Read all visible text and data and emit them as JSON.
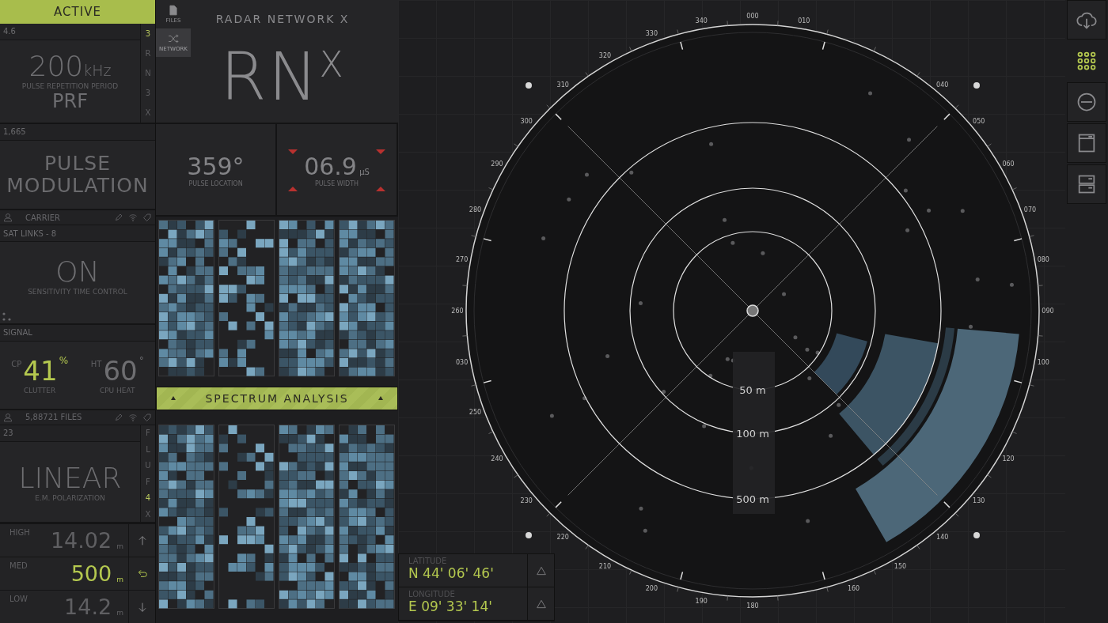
{
  "status": {
    "label": "ACTIVE"
  },
  "prf": {
    "header": "4.6",
    "value": "200",
    "unit": "kHz",
    "label": "PULSE REPETITION PERIOD",
    "code": "PRF",
    "side": [
      {
        "label": "3",
        "selected": true
      },
      {
        "label": "R",
        "selected": false
      },
      {
        "label": "N",
        "selected": false
      },
      {
        "label": "3",
        "selected": false
      },
      {
        "label": "X",
        "selected": false
      }
    ]
  },
  "modulation": {
    "header": "1,665",
    "value": "PULSE MODULATION",
    "footer": "CARRIER"
  },
  "stc": {
    "header": "SAT LINKS - 8",
    "value": "ON",
    "label": "SENSITIVITY TIME CONTROL"
  },
  "signal": {
    "header": "SIGNAL",
    "footer": "5,88721 FILES",
    "gauges": [
      {
        "prefix": "CP",
        "value": "41",
        "unit": "%",
        "label": "CLUTTER",
        "selected": true
      },
      {
        "prefix": "HT",
        "value": "60",
        "unit": "°",
        "label": "CPU HEAT",
        "selected": false
      }
    ]
  },
  "polarization": {
    "header": "23",
    "value": "LINEAR",
    "label": "E.M. POLARIZATION",
    "side": [
      {
        "label": "F",
        "selected": false
      },
      {
        "label": "L",
        "selected": false
      },
      {
        "label": "U",
        "selected": false
      },
      {
        "label": "F",
        "selected": false
      },
      {
        "label": "4",
        "selected": true
      },
      {
        "label": "X",
        "selected": false
      }
    ]
  },
  "altitudes": [
    {
      "label": "HIGH",
      "value": "14.02",
      "unit": "m",
      "kind": "up",
      "selected": false
    },
    {
      "label": "MED",
      "value": "500",
      "unit": "m",
      "kind": "back",
      "selected": true
    },
    {
      "label": "LOW",
      "value": "14.2",
      "unit": "m",
      "kind": "down",
      "selected": false
    }
  ],
  "nav": [
    {
      "label": "FILES",
      "kind": "file",
      "selected": false
    },
    {
      "label": "NETWORK",
      "kind": "shuffle",
      "selected": true
    }
  ],
  "header": {
    "subtitle": "RADAR NETWORK X",
    "logo": "RN$^{X}$"
  },
  "readouts": [
    {
      "value": "359°",
      "label": "PULSE LOCATION",
      "kind": "plain"
    },
    {
      "value": "06.9",
      "unit": "µS",
      "label": "PULSE WIDTH",
      "kind": "adjustable"
    }
  ],
  "spectrum": {
    "label": "SPECTRUM ANALYSIS"
  },
  "radar": {
    "bearings": [
      "000",
      "010",
      "040",
      "050",
      "060",
      "070",
      "080",
      "090",
      "100",
      "120",
      "130",
      "140",
      "150",
      "160",
      "180",
      "190",
      "200",
      "210",
      "220",
      "230",
      "240",
      "250",
      "030",
      "260",
      "270",
      "280",
      "290",
      "300",
      "310",
      "320",
      "330",
      "340"
    ],
    "ranges": [
      "50 m",
      "100 m",
      "500 m"
    ]
  },
  "coordinates": [
    {
      "label": "LATITUDE",
      "value": "N 44' 06' 46'"
    },
    {
      "label": "LONGITUDE",
      "value": "E 09' 33' 14'"
    }
  ],
  "toolbar": [
    {
      "kind": "cloud-download",
      "selected": false
    },
    {
      "kind": "grid",
      "selected": true
    },
    {
      "kind": "minus",
      "selected": false
    },
    {
      "kind": "window",
      "selected": false
    },
    {
      "kind": "server",
      "selected": false
    }
  ]
}
